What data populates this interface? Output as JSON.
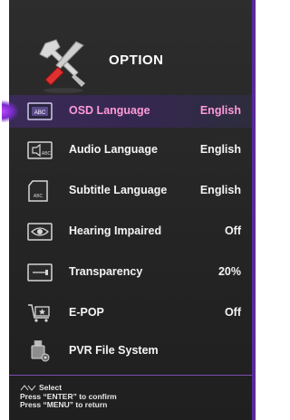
{
  "header": {
    "title": "OPTION",
    "icon": "tools-icon"
  },
  "menu": {
    "items": [
      {
        "label": "OSD Language",
        "value": "English",
        "icon": "osd-language-icon",
        "selected": true
      },
      {
        "label": "Audio Language",
        "value": "English",
        "icon": "audio-language-icon"
      },
      {
        "label": "Subtitle Language",
        "value": "English",
        "icon": "subtitle-language-icon"
      },
      {
        "label": "Hearing Impaired",
        "value": "Off",
        "icon": "eye-icon"
      },
      {
        "label": "Transparency",
        "value": "20%",
        "icon": "transparency-icon"
      },
      {
        "label": "E-POP",
        "value": "Off",
        "icon": "cart-icon"
      },
      {
        "label": "PVR File System",
        "value": "",
        "icon": "usb-disk-icon"
      }
    ],
    "icon_badge_text": "ABC"
  },
  "footer": {
    "select_text": "Select",
    "confirm_text": "Press “ENTER” to confirm",
    "return_text": "Press “MENU” to return"
  },
  "colors": {
    "accent": "#5a2a9a",
    "selected_text": "#ff9ad8",
    "background": "#262626"
  }
}
